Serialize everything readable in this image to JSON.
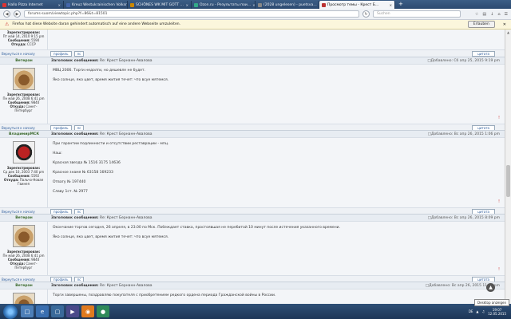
{
  "browser": {
    "tabs": [
      {
        "label": "Hallo Pizza Internet",
        "color": "#d33",
        "active": false
      },
      {
        "label": "Kreuz Westukrainischen Volksrepublik",
        "color": "#46a",
        "active": false
      },
      {
        "label": "SCHÖNES WK MIT GOTT …",
        "color": "#c80",
        "active": false
      },
      {
        "label": "Ozon.ru - Результаты пои…",
        "color": "#3a8",
        "active": false
      },
      {
        "label": "(2028 ungelesen) - puetsva…",
        "color": "#888",
        "active": false
      },
      {
        "label": "Просмотр темы - Крест Б…",
        "color": "#b33",
        "active": true
      }
    ],
    "new_tab": "+",
    "url": "forums-suom/viewtopic.php?f=86&t=81501",
    "search_placeholder": "Suchen",
    "notification": "Firefox hat diese Website daran gehindert automatisch auf eine andere Webseite umzuleiten.",
    "notification_button": "Erlauben"
  },
  "top_fragment": {
    "registered_label": "Зарегистрирован:",
    "registered": "Пт май 14, 2010 9:15 pm",
    "messages_label": "Сообщения:",
    "messages": "5590",
    "from_label": "Откуда:",
    "from": "СССР",
    "to_top": "Вернуться к началу",
    "profile_btn": "профиль",
    "pm_btn": "лс",
    "quote_btn": "цитата"
  },
  "posts": [
    {
      "author": "Ветеран",
      "subject_label": "Заголовок сообщения:",
      "subject": "Re: Крест Бернанн-Авалова",
      "posted": "Добавлено: Сб апр 25, 2015 9:19 pm",
      "avatar": "coin",
      "registered_label": "Зарегистрирован:",
      "registered": "Пн май 26, 2008 6:41 pm",
      "messages_label": "Сообщения:",
      "messages": "9840",
      "from_label": "Откуда:",
      "from": "Санкт-Петербург",
      "lines": [
        "МВЦ 2006. Торги недолги, но дешевле не будет.",
        "Яко солнце, яко цвет, время жития течет: что всуе мятемся."
      ],
      "to_top": "Вернуться к началу",
      "profile_btn": "профиль",
      "pm_btn": "лс",
      "quote_btn": "цитата"
    },
    {
      "author": "ВладимирМСК",
      "subject_label": "Заголовок сообщения:",
      "subject": "Re: Крест Бернанн-Авалова",
      "posted": "Добавлено: Вс апр 26, 2015 1:06 pm",
      "avatar": "stop",
      "registered_label": "Зарегистрирован:",
      "registered": "Ср дек 10, 2003 7:40 pm",
      "messages_label": "Сообщения:",
      "messages": "5592",
      "from_label": "Откуда:",
      "from": "Пальчо-Новая Гвинея",
      "lines": [
        "При гарантии подлинности и отсутствии реставрации - мпц.",
        "",
        "Наш:",
        "Красная звезда № 1516 3175 14636",
        "Красное знамя № 63158 169233",
        "Отвагу № 197440",
        "Славу 1ст. № 2977"
      ],
      "to_top": "Вернуться к началу",
      "profile_btn": "профиль",
      "pm_btn": "лс",
      "quote_btn": "цитата"
    },
    {
      "author": "Ветеран",
      "subject_label": "Заголовок сообщения:",
      "subject": "Re: Крест Бернанн-Авалова",
      "posted": "Добавлено: Вс апр 26, 2015 8:09 pm",
      "avatar": "coin",
      "registered_label": "Зарегистрирован:",
      "registered": "Пн май 26, 2008 6:41 pm",
      "messages_label": "Сообщения:",
      "messages": "9840",
      "from_label": "Откуда:",
      "from": "Санкт-Петербург",
      "lines": [
        "Окончание торгов сегодня, 26 апреля, в 23.00 по Мск. Побеждает ставка, простоявшая не перебитой 10 минут после истечения указанного времени.",
        "Яко солнце, яко цвет, время жития течет: что всуе мятемся."
      ],
      "to_top": "Вернуться к началу",
      "profile_btn": "профиль",
      "pm_btn": "лс",
      "quote_btn": "цитата"
    },
    {
      "author": "Ветеран",
      "subject_label": "Заголовок сообщения:",
      "subject": "Re: Крест Бернанн-Авалова",
      "posted": "Добавлено: Вс апр 26, 2015 11:16 pm",
      "avatar": "coin",
      "lines": [
        "Торги завершены, поздравляю покупателя с приобретением редкого ордена периода Гражданской войны в России."
      ]
    }
  ],
  "taskbar": {
    "lang": "DE",
    "time": "19:07",
    "date": "12.05.2015",
    "desktop_tip": "Desktop anzeigen"
  }
}
